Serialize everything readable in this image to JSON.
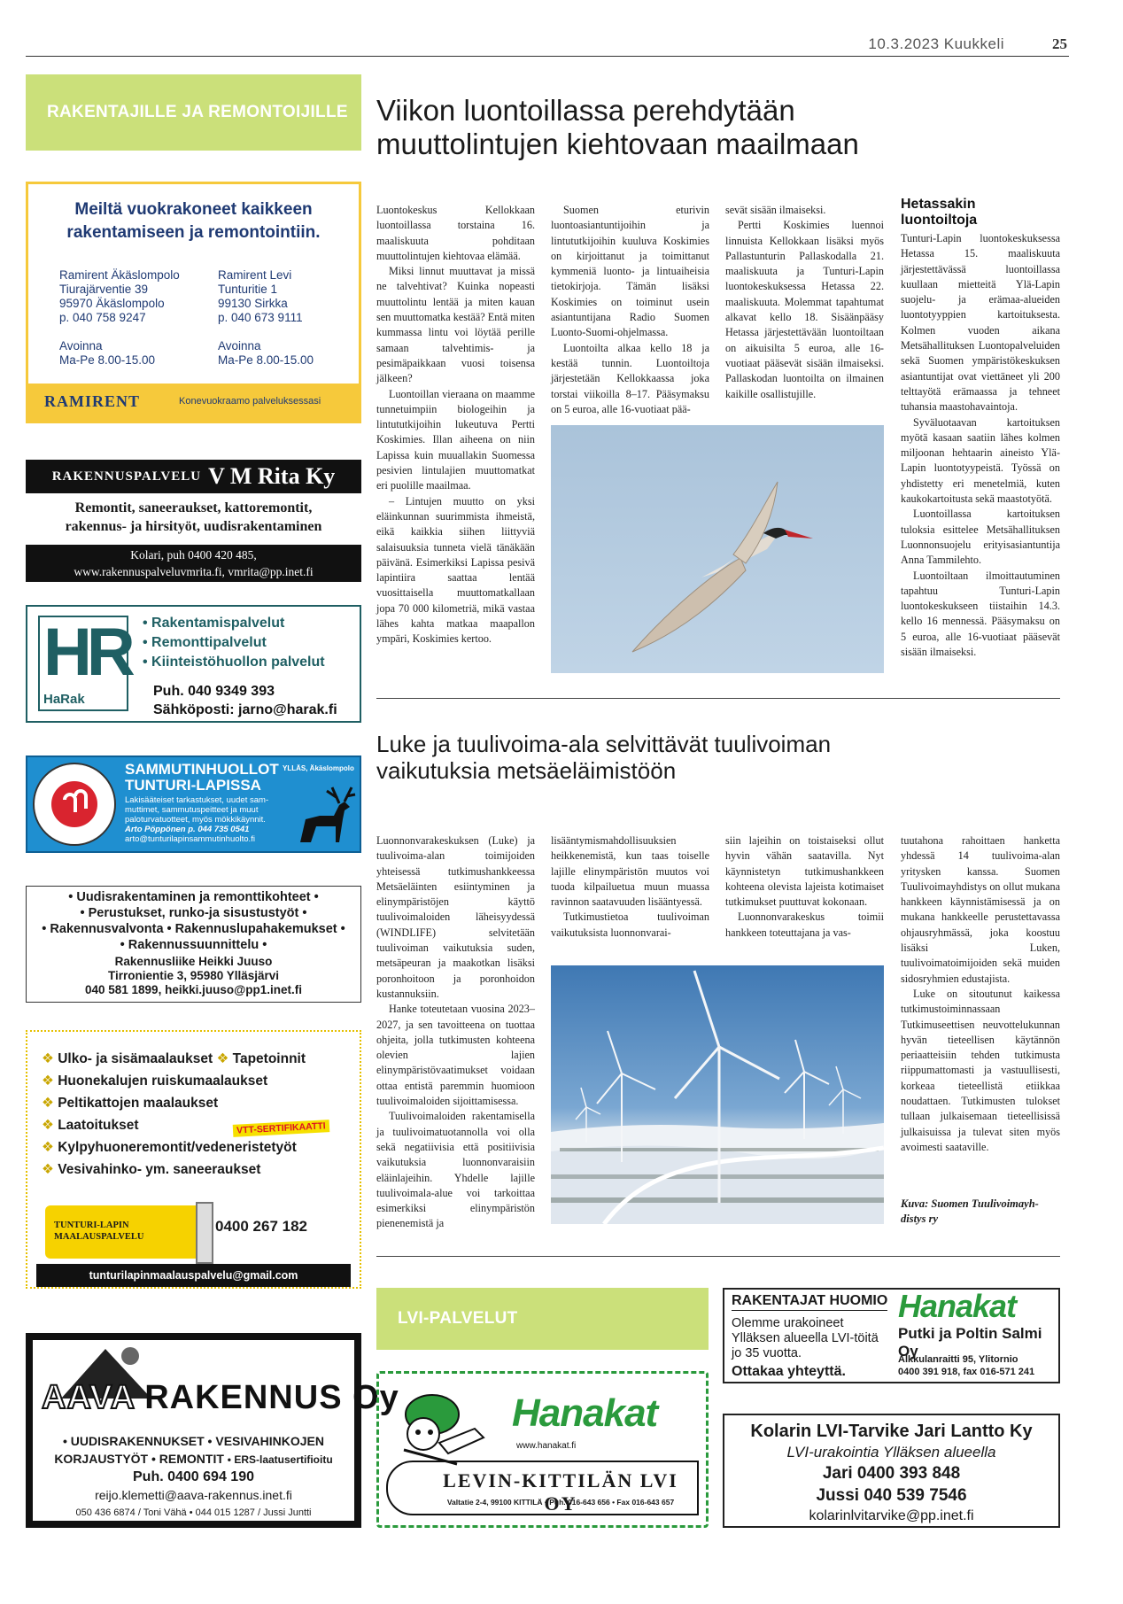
{
  "header": {
    "date_paper": "10.3.2023 Kuukkeli",
    "page": "25"
  },
  "left_band": "RAKENTAJILLE JA REMONTOIJILLE",
  "article1": {
    "title_line1": "Viikon luontoillassa perehdytään",
    "title_line2": "muuttolintujen kiehtovaan maailmaan",
    "col1": [
      "Luontokeskus Kellokkaan luontoillassa torstaina 16. maaliskuuta pohditaan muuttolintujen kiehtovaa elämää.",
      "Miksi linnut muuttavat ja missä ne talvehtivat? Kuinka nopeasti muuttolintu lentää ja miten kauan sen muuttomatka kestää? Entä miten kummassa lintu voi löytää perille samaan talvehtimis- ja pesimäpaikkaan vuosi toisensa jälkeen?",
      "Luontoillan vieraana on maamme tunnetuimpiin biologeihin ja lintututkijoihin lukeutuva Pertti Koskimies. Illan aiheena on niin Lapissa kuin muuallakin Suomessa pesivien lintulajien muuttomatkat eri puolille maailmaa.",
      "– Lintujen muutto on yksi eläinkunnan suurimmista ihmeistä, eikä kaikkia siihen liittyviä salaisuuksia tunneta vielä tänäkään päivänä. Esimerkiksi Lapissa pesivä lapintiira saattaa lentää vuosittaisella muuttomatkallaan jopa 70 000 kilometriä, mikä vastaa lähes kahta matkaa maapallon ympäri, Koskimies kertoo."
    ],
    "col2": [
      "Suomen eturivin luontoasiantuntijoihin ja lintututkijoihin kuuluva Koskimies on kirjoittanut ja toimittanut kymmeniä luonto- ja lintuaiheisia tietokirjoja. Tämän lisäksi Koskimies on toiminut usein asiantuntijana Radio Suomen Luonto-Suomi-ohjelmassa.",
      "Luontoilta alkaa kello 18 ja kestää tunnin. Luontoiltoja järjestetään Kellokkaassa joka torstai viikoilla 8–17. Pääsymaksu on 5 euroa, alle 16-vuotiaat pää-"
    ],
    "col3": [
      "sevät sisään ilmaiseksi.",
      "Pertti Koskimies luennoi linnuista Kellokkaan lisäksi myös Pallastunturin Pallaskodalla 21. maaliskuuta ja Tunturi-Lapin luontokeskuksessa Hetassa 22. maaliskuuta. Molemmat tapahtumat alkavat kello 18. Sisäänpääsy Hetassa järjestettävään luontoiltaan on aikuisilta 5 euroa, alle 16-vuotiaat pääsevät sisään ilmaiseksi. Pallaskodan luontoilta on ilmainen kaikille osallistujille."
    ],
    "side_heading_line1": "Hetassakin",
    "side_heading_line2": "luontoiltoja",
    "side": [
      "Tunturi-Lapin luontokeskuksessa Hetassa 15. maaliskuuta järjestettävässä luontoillassa kuullaan mietteitä Ylä-Lapin suojelu- ja erämaa-alueiden luontotyyppien kartoituksesta. Kolmen vuoden aikana Metsähallituksen Luontopalveluiden sekä Suomen ympäristökeskuksen asiantuntijat ovat viettäneet yli 200 telttayötä erämaassa ja tehneet tuhansia maastohavaintoja.",
      "Syväluotaavan kartoituksen myötä kasaan saatiin lähes kolmen miljoonan hehtaarin aineisto Ylä-Lapin luontotyypeistä. Työssä on yhdistetty eri menetelmiä, kuten kaukokartoitusta sekä maastotyötä.",
      "Luontoillassa kartoituksen tuloksia esittelee Metsähallituksen Luonnonsuojelu erityisasiantuntija Anna Tammilehto.",
      "Luontoiltaan ilmoittautuminen tapahtuu Tunturi-Lapin luontokeskukseen tiistaihin 14.3. kello 16 mennessä. Pääsymaksu on 5 euroa, alle 16-vuotiaat pääsevät sisään ilmaiseksi."
    ]
  },
  "article2": {
    "title_line1": "Luke ja tuulivoima-ala selvittävät tuulivoiman",
    "title_line2": "vaikutuksia metsäeläimistöön",
    "col1": [
      "Luonnonvarakeskuksen (Luke) ja tuulivoima-alan toimijoiden yhteisessä tutkimushankkeessa Metsäeläinten esiintyminen ja elinympäristöjen käyttö tuulivoimaloiden läheisyydessä (WINDLIFE) selvitetään tuulivoiman vaikutuksia suden, metsäpeuran ja maakotkan lisäksi poronhoitoon ja poronhoidon kustannuksiin.",
      "Hanke toteutetaan vuosina 2023–2027, ja sen tavoitteena on tuottaa ohjeita, jolla tutkimusten kohteena olevien lajien elinympäristövaatimukset voidaan ottaa entistä paremmin huomioon tuulivoimaloiden sijoittamisessa.",
      "Tuulivoimaloiden rakentamisella ja tuulivoimatuotannolla voi olla sekä negatiivisia että positiivisia vaikutuksia luonnonvaraisiin eläinlajeihin. Yhdelle lajille tuulivoimala-alue voi tarkoittaa esimerkiksi elinympäristön pienenemistä ja"
    ],
    "col2": [
      "lisääntymismahdollisuuksien heikkenemistä, kun taas toiselle lajille elinympäristön muutos voi tuoda kilpailuetua muun muassa ravinnon saatavuuden lisääntyessä.",
      "Tutkimustietoa tuulivoiman vaikutuksista luonnonvarai-"
    ],
    "col3": [
      "siin lajeihin on toistaiseksi ollut hyvin vähän saatavilla. Nyt käynnistetyn tutkimushankkeen kohteena olevista lajeista kotimaiset tutkimukset puuttuvat kokonaan.",
      "Luonnonvarakeskus toimii hankkeen toteuttajana ja vas-"
    ],
    "side": [
      "tuutahona rahoittaen hanketta yhdessä 14 tuulivoima-alan yritysken kanssa. Suomen Tuulivoimayhdistys on ollut mukana hankkeen käynnistämisessä ja on mukana hankkeelle perustettavassa ohjausryhmässä, joka koostuu lisäksi Luken, tuulivoimatoimijoiden sekä muiden sidosryhmien edustajista.",
      "Luke on sitoutunut kaikessa tutkimustoiminnassaan Tutkimuseettisen neuvottelukunnan hyvän tieteellisen käytännön periaatteisiin tehden tutkimusta riippumattomasti ja vastuullisesti, korkeaa tieteellistä etiikkaa noudattaen. Tutkimusten tulokset tullaan julkaisemaan tieteellisissä julkaisuissa ja tulevat siten myös avoimesti saataville."
    ],
    "caption_line1": "Kuva: Suomen Tuulivoimayh-",
    "caption_line2": "distys ry"
  },
  "ads": {
    "ramirent": {
      "headline_line1": "Meiltä vuokrakoneet kaikkeen",
      "headline_line2": "rakentamiseen ja remontointiin.",
      "a_name": "Ramirent Äkäslompolo",
      "a_street": "Tiurajärventie 39",
      "a_city": "95970 Äkäslompolo",
      "a_phone": "p. 040 758 9247",
      "b_name": "Ramirent Levi",
      "b_street": "Tunturitie 1",
      "b_city": "99130 Sirkka",
      "b_phone": "p. 040 673 9111",
      "open_label": "Avoinna",
      "open_hours": "Ma-Pe 8.00-15.00",
      "logo": "RAMIRENT",
      "slogan": "Konevuokraamo palveluksessasi"
    },
    "vmrita": {
      "title_a": "Rakennuspalvelu",
      "title_b": "V M Rita Ky",
      "line1": "Remontit, saneeraukset, kattoremontit,",
      "line2": "rakennus- ja hirsityöt, uudisrakentaminen",
      "contact1": "Kolari, puh 0400 420 485,",
      "contact2": "www.rakennuspalveluvmrita.fi, vmrita@pp.inet.fi"
    },
    "harak": {
      "logo_letters": "HR",
      "logo_name": "HaRak",
      "s1": "• Rakentamispalvelut",
      "s2": "• Remonttipalvelut",
      "s3": "• Kiinteistöhuollon palvelut",
      "phone": "Puh. 040 9349 393",
      "email": "Sähköposti: jarno@harak.fi"
    },
    "sammutin": {
      "title1": "SAMMUTINHUOLLOT",
      "location": "YLLÄS, Äkäslompolo",
      "title2": "TUNTURI-LAPISSA",
      "desc1": "Lakisääteiset tarkastukset, uudet sam-",
      "desc2": "muttimet, sammutuspeitteet ja muut",
      "desc3": "paloturvatuotteet, myös mökkikäynnit.",
      "contact": "Arto Pöppönen p. 044 735 0541",
      "email": "arto@tunturilapinsammutinhuolto.fi"
    },
    "juuso": {
      "l1": "• Uudisrakentaminen ja remonttikohteet •",
      "l2": "• Perustukset, runko-ja sisustustyöt •",
      "l3": "• Rakennusvalvonta • Rakennuslupahakemukset •",
      "l4": "• Rakennussuunnittelu •",
      "name": "Rakennusliike Heikki Juuso",
      "addr": "Tirronientie 3, 95980 Ylläsjärvi",
      "contact": "040 581 1899, heikki.juuso@pp1.inet.fi"
    },
    "maalaus": {
      "s1": "Ulko- ja sisämaalaukset",
      "s1b": "Tapetoinnit",
      "s2": "Huonekalujen ruiskumaalaukset",
      "s3": "Peltikattojen maalaukset",
      "s4": "Laatoitukset",
      "badge": "VTT-SERTIFIKAATTI",
      "s5": "Kylpyhuoneremontit/vedeneristetyöt",
      "s6": "Vesivahinko- ym. saneeraukset",
      "name1": "TUNTURI-LAPIN",
      "name2": "MAALAUSPALVELU",
      "phone": "0400 267 182",
      "email": "tunturilapinmaalauspalvelu@gmail.com"
    },
    "aava": {
      "logo_a": "AAVA",
      "logo_b": "RAKENNUS Oy",
      "l1": "• UUDISRAKENNUKSET • VESIVAHINKOJEN",
      "l2a": "KORJAUSTYÖT • REMONTIT",
      "l2b": "• ERS-laatusertifioitu",
      "phone": "Puh. 0400 694 190",
      "email": "reijo.klemetti@aava-rakennus.inet.fi",
      "people": "050 436 6874 / Toni Vähä • 044 015 1287 / Jussi Juntti"
    },
    "lvi_band": "LVI-PALVELUT",
    "levikittila": {
      "logo": "Hanakat",
      "web": "www.hanakat.fi",
      "name": "Levin-Kittilän LVI Oy",
      "addr": "Valtatie 2-4, 99100 KITTILÄ • Puh. 016-643 656 • Fax 016-643 657"
    },
    "salmi": {
      "title": "RAKENTAJAT HUOMIO",
      "l1": "Olemme urakoineet",
      "l2": "Ylläksen alueella LVI-töitä",
      "l3": "jo 35 vuotta.",
      "cta": "Ottakaa yhteyttä.",
      "logo": "Hanakat",
      "name": "Putki ja Poltin Salmi Oy",
      "addr": "Alkkulanraitti 95, Ylitornio",
      "phone": "0400 391 918, fax 016-571 241"
    },
    "kolari": {
      "name": "Kolarin LVI-Tarvike Jari Lantto Ky",
      "sub": "LVI-urakointia Ylläksen alueella",
      "p1": "Jari  0400 393 848",
      "p2": "Jussi 040 539 7546",
      "email": "kolarinlvitarvike@pp.inet.fi"
    }
  },
  "colors": {
    "band": "#cbe07a",
    "ramirent_yellow": "#f6c93b",
    "ramirent_blue": "#1f3a73",
    "harak_teal": "#1f5f63",
    "sammutin_blue": "#1f8fd0"
  }
}
